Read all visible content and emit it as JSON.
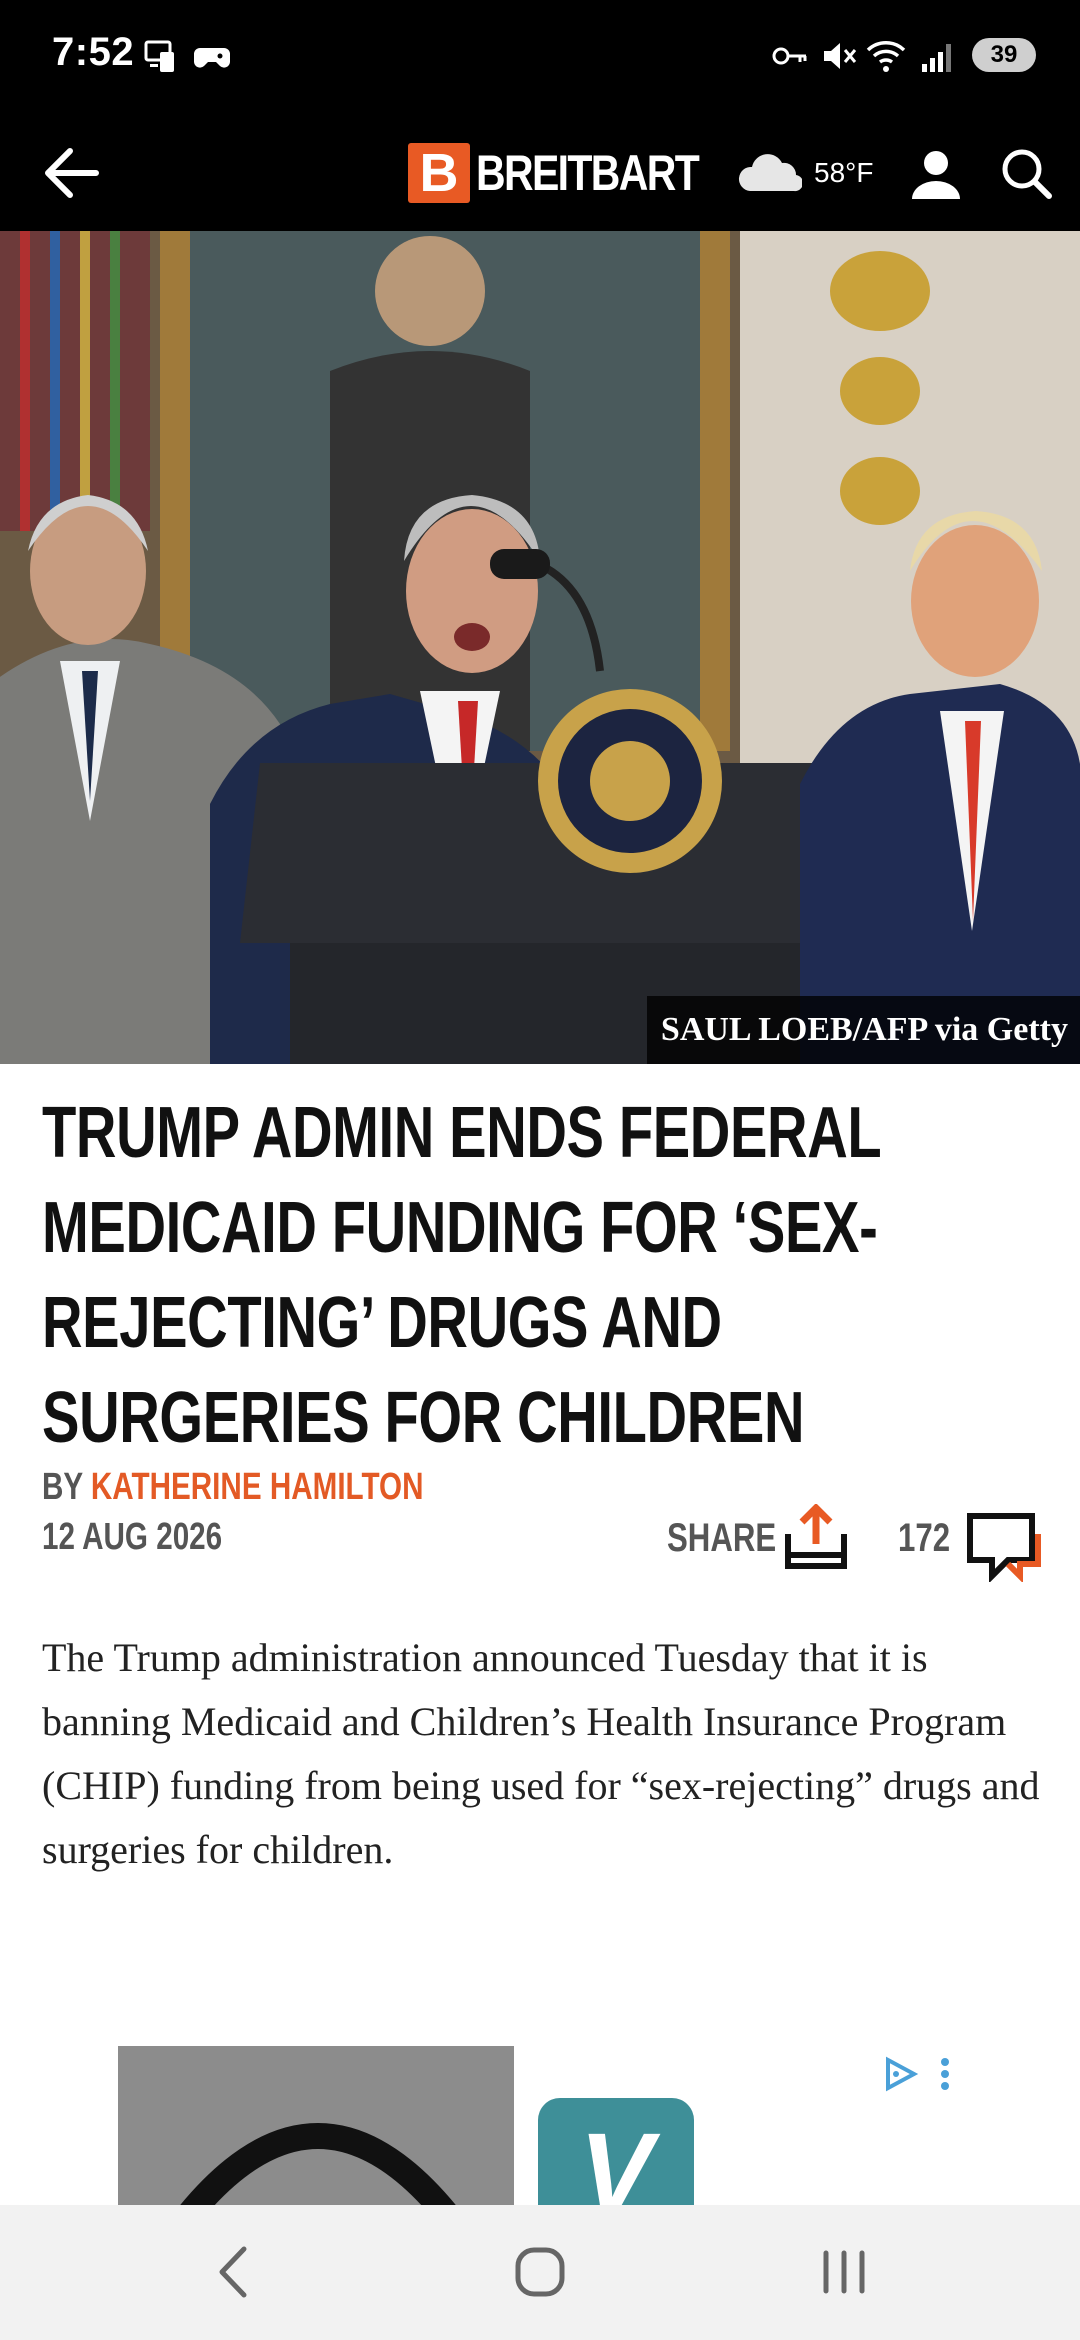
{
  "status_bar": {
    "time": "7:52",
    "battery": "39",
    "left_icons": [
      "screen-mirror-icon",
      "game-controller-icon"
    ],
    "right_icons": [
      "vpn-key-icon",
      "mute-icon",
      "wifi-icon",
      "signal-icon"
    ]
  },
  "header": {
    "logo_letter": "B",
    "logo_text": "BREITBART",
    "weather_temp": "58°F",
    "icons": [
      "back-arrow-icon",
      "cloud-icon",
      "user-icon",
      "search-icon"
    ]
  },
  "hero": {
    "photo_credit": "SAUL LOEB/AFP via Getty"
  },
  "article": {
    "headline": "TRUMP ADMIN ENDS FEDERAL MEDICAID FUNDING FOR ‘SEX-REJECTING’ DRUGS AND SURGERIES FOR CHILDREN",
    "byline_prefix": "BY",
    "author": "KATHERINE HAMILTON",
    "date": "12 AUG 2026",
    "share_label": "SHARE",
    "comment_count": "172",
    "body": "The Trump administration announced Tuesday that it is banning Medicaid and Children’s Health Insurance Program (CHIP) funding from being used for “sex-rejecting” drugs and surgeries for children."
  },
  "ad": {
    "logo_letter": "V"
  },
  "colors": {
    "brand_orange": "#e85a24",
    "header_bg": "#000000",
    "text_gray": "#555555",
    "ad_teal": "#3e8f98"
  }
}
